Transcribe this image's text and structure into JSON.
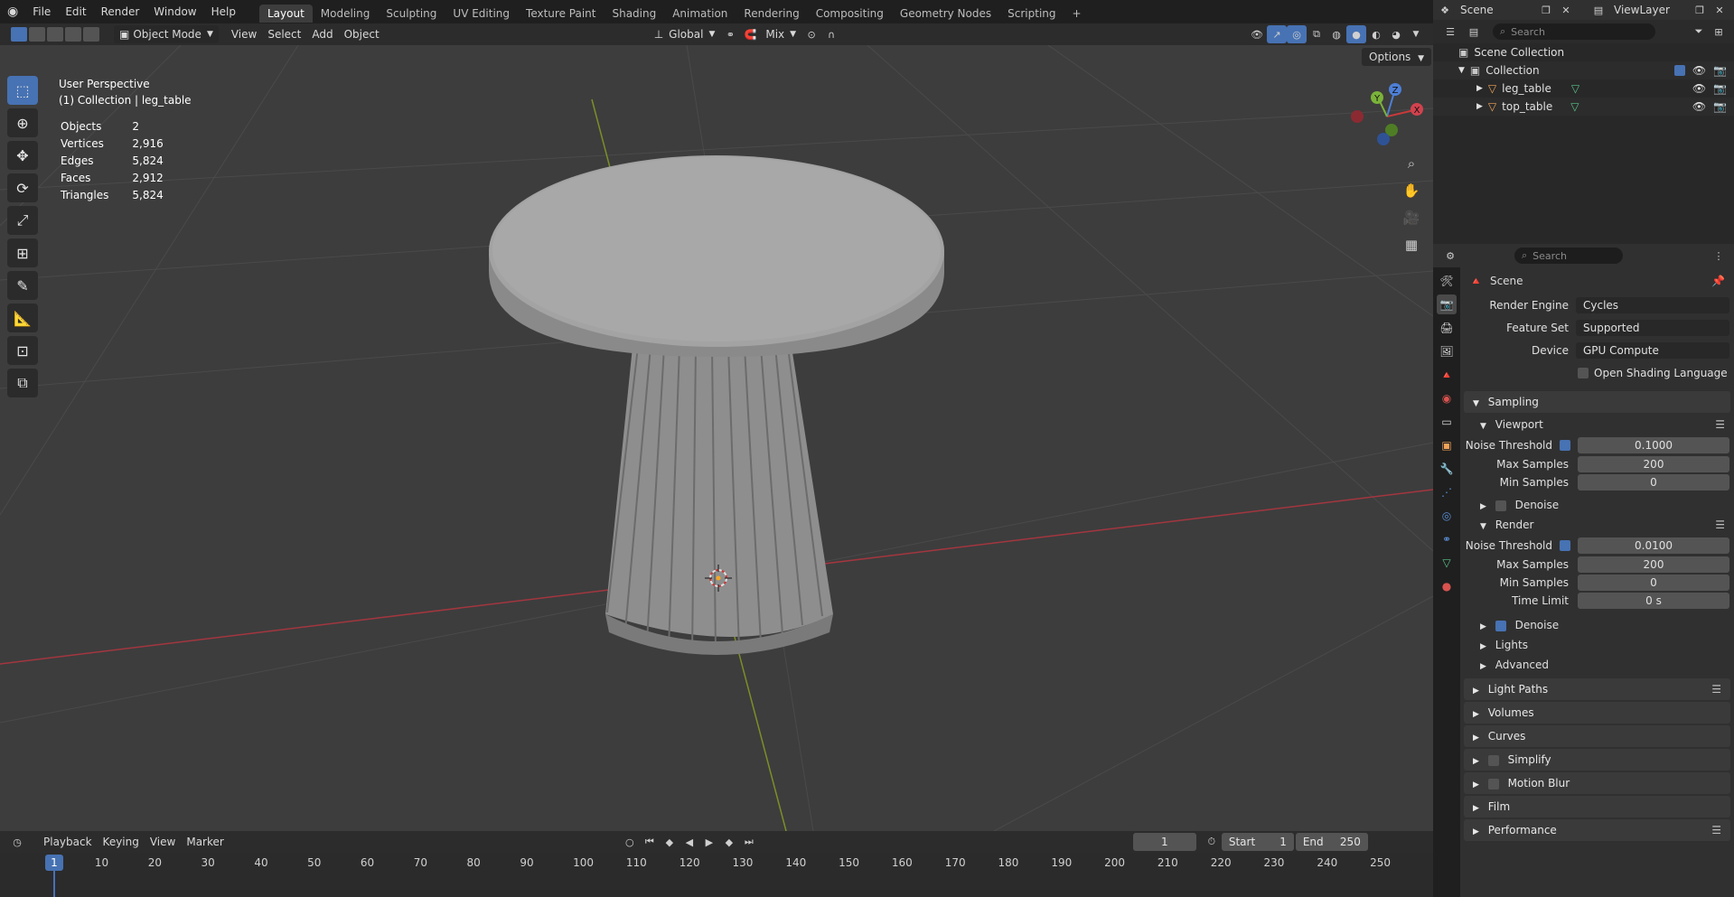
{
  "topbar": {
    "menus": [
      "File",
      "Edit",
      "Render",
      "Window",
      "Help"
    ],
    "workspaces": [
      "Layout",
      "Modeling",
      "Sculpting",
      "UV Editing",
      "Texture Paint",
      "Shading",
      "Animation",
      "Rendering",
      "Compositing",
      "Geometry Nodes",
      "Scripting"
    ],
    "active_workspace": "Layout",
    "add_tab": "+"
  },
  "scene_bar": {
    "scene": "Scene",
    "view_layer": "ViewLayer"
  },
  "viewport_header": {
    "mode": "Object Mode",
    "menus": [
      "View",
      "Select",
      "Add",
      "Object"
    ],
    "orientation": "Global",
    "snap": "Mix",
    "options": "Options"
  },
  "viewport_overlay": {
    "perspective": "User Perspective",
    "collection": "(1) Collection | leg_table",
    "stats": [
      {
        "label": "Objects",
        "value": "2"
      },
      {
        "label": "Vertices",
        "value": "2,916"
      },
      {
        "label": "Edges",
        "value": "5,824"
      },
      {
        "label": "Faces",
        "value": "2,912"
      },
      {
        "label": "Triangles",
        "value": "5,824"
      }
    ]
  },
  "gizmo": {
    "x": "X",
    "y": "Y",
    "z": "Z"
  },
  "timeline": {
    "menus": [
      "Playback",
      "Keying",
      "View",
      "Marker"
    ],
    "current_frame": "1",
    "start_label": "Start",
    "start": "1",
    "end_label": "End",
    "end": "250",
    "ticks": [
      "1",
      "10",
      "20",
      "30",
      "40",
      "50",
      "60",
      "70",
      "80",
      "90",
      "100",
      "110",
      "120",
      "130",
      "140",
      "150",
      "160",
      "170",
      "180",
      "190",
      "200",
      "210",
      "220",
      "230",
      "240",
      "250"
    ]
  },
  "outliner": {
    "search_placeholder": "Search",
    "root": "Scene Collection",
    "collection": "Collection",
    "objects": [
      "leg_table",
      "top_table"
    ]
  },
  "properties": {
    "search_placeholder": "Search",
    "context": "Scene",
    "render_engine_label": "Render Engine",
    "render_engine": "Cycles",
    "feature_set_label": "Feature Set",
    "feature_set": "Supported",
    "device_label": "Device",
    "device": "GPU Compute",
    "osl": "Open Shading Language",
    "sampling": "Sampling",
    "viewport": "Viewport",
    "noise_threshold_label": "Noise Threshold",
    "viewport_noise": "0.1000",
    "max_samples_label": "Max Samples",
    "viewport_max": "200",
    "min_samples_label": "Min Samples",
    "viewport_min": "0",
    "denoise": "Denoise",
    "render": "Render",
    "render_noise": "0.0100",
    "render_max": "200",
    "render_min": "0",
    "time_limit_label": "Time Limit",
    "time_limit": "0 s",
    "lights": "Lights",
    "advanced": "Advanced",
    "panels": [
      "Light Paths",
      "Volumes",
      "Curves",
      "Simplify",
      "Motion Blur",
      "Film",
      "Performance"
    ]
  }
}
